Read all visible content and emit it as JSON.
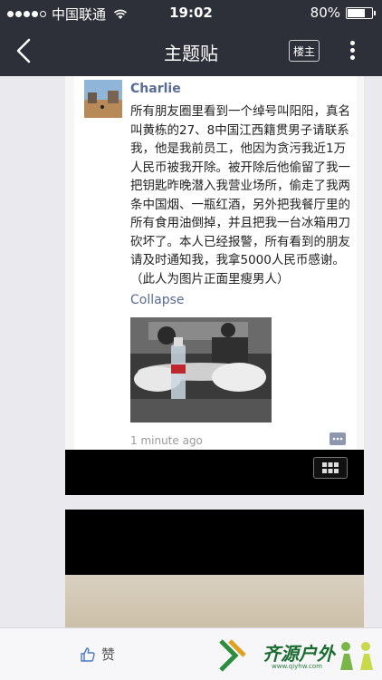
{
  "status_bar": {
    "carrier": "中国联通",
    "time": "19:02",
    "battery_text": "80%",
    "battery_level": 0.8
  },
  "nav": {
    "title": "主题贴",
    "louzhu_label": "楼主",
    "back_icon": "chevron-left-icon",
    "more_icon": "more-vertical-icon"
  },
  "post": {
    "username": "Charlie",
    "text": "所有朋友圈里看到一个绰号叫阳阳，真名叫黄栋的27、8中国江西籍贯男子请联系我，他是我前员工，他因为贪污我近1万人民币被我开除。被开除后他偷留了我一把钥匙昨晚潜入我营业场所，偷走了我两条中国烟、一瓶红酒，另外把我餐厅里的所有食用油倒掉，并且把我一台冰箱用刀砍坏了。本人已经报警，所有看到的朋友请及时通知我，我拿5000人民币感谢。 （此人为图片正面里瘦男人）",
    "collapse_label": "Collapse",
    "timestamp": "1 minute ago"
  },
  "bottom": {
    "like_label": "赞",
    "watermark_text": "齐源户外",
    "watermark_url": "www.qiyhw.com"
  },
  "colors": {
    "bar_bg": "#2d3038",
    "link": "#576b95",
    "watermark_green": "#1a6b2f"
  }
}
